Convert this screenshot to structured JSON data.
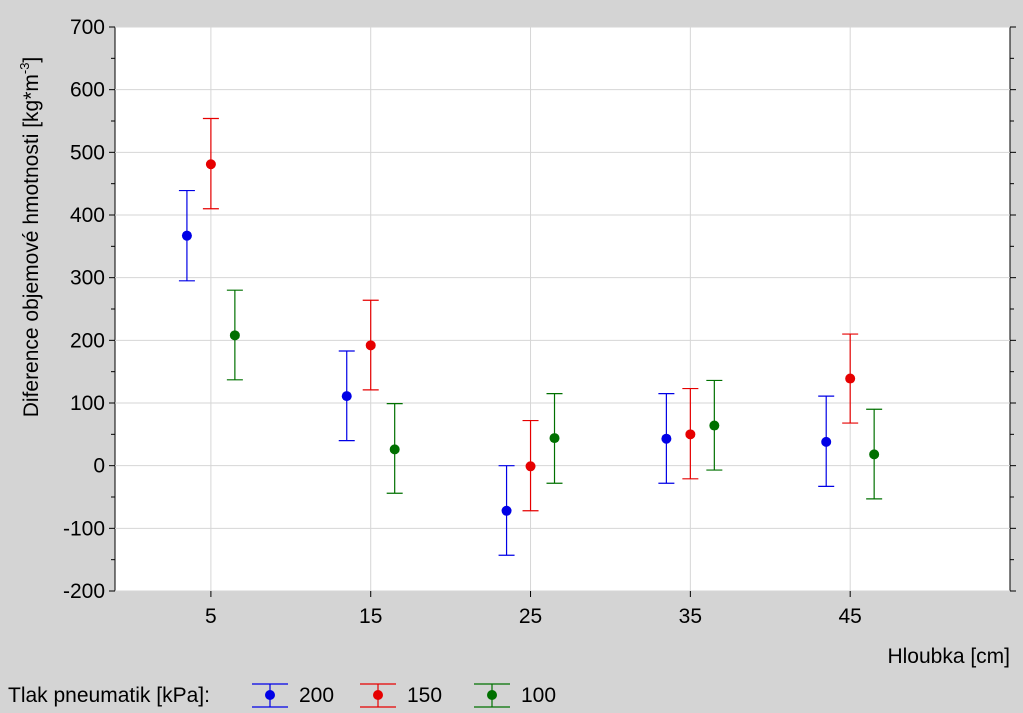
{
  "chart_data": {
    "type": "scatter",
    "title": "",
    "xlabel": "Hloubka [cm]",
    "ylabel": "Diference objemové hmotnosti [kg*m",
    "ylabel_superscript": "-3",
    "ylabel_close": "]",
    "xlim": [
      -1,
      55
    ],
    "ylim": [
      -200,
      700
    ],
    "x_ticks": [
      5,
      15,
      25,
      35,
      45
    ],
    "y_ticks": [
      -200,
      -100,
      0,
      100,
      200,
      300,
      400,
      500,
      600,
      700
    ],
    "grid": true,
    "legend_title": "Tlak pneumatik [kPa]:",
    "legend_position": "bottom-left",
    "series": [
      {
        "name": "200",
        "color": "#0000e6",
        "x": [
          5,
          15,
          25,
          35,
          45
        ],
        "offset": -1.5,
        "y": [
          367,
          111,
          -72,
          43,
          38
        ],
        "lower": [
          295,
          40,
          -143,
          -28,
          -33
        ],
        "upper": [
          439,
          183,
          0,
          115,
          111
        ]
      },
      {
        "name": "150",
        "color": "#e60000",
        "x": [
          5,
          15,
          25,
          35,
          45
        ],
        "offset": 0,
        "y": [
          481,
          192,
          -1,
          50,
          139
        ],
        "lower": [
          410,
          121,
          -72,
          -21,
          68
        ],
        "upper": [
          554,
          264,
          72,
          123,
          210
        ]
      },
      {
        "name": "100",
        "color": "#007000",
        "x": [
          5,
          15,
          25,
          35,
          45
        ],
        "offset": 1.5,
        "y": [
          208,
          26,
          44,
          64,
          18
        ],
        "lower": [
          137,
          -44,
          -28,
          -7,
          -53
        ],
        "upper": [
          280,
          99,
          115,
          136,
          90
        ]
      }
    ]
  }
}
